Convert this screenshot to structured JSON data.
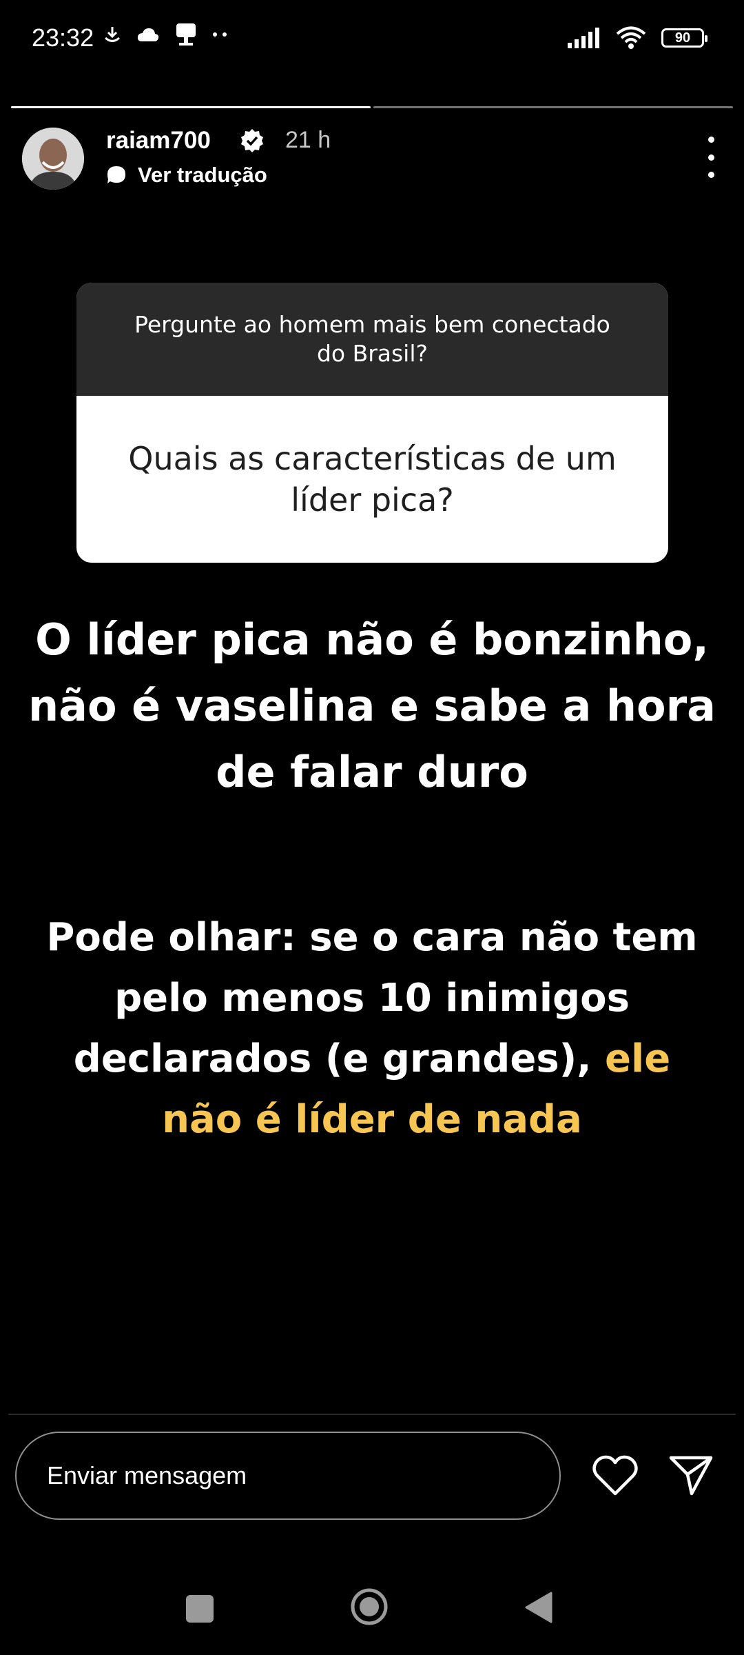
{
  "status_bar": {
    "time": "23:32",
    "battery": "90",
    "left_icons": [
      "download-icon",
      "cloud-icon",
      "mailbox-icon",
      "dots-icon"
    ],
    "right_icons": [
      "signal-icon",
      "wifi-icon",
      "battery-icon"
    ]
  },
  "story": {
    "segments_total": 2,
    "segments_done": 1,
    "username": "raiam700",
    "verified": true,
    "time_ago": "21 h",
    "translate_label": "Ver tradução"
  },
  "question_box": {
    "prompt": "Pergunte ao homem mais bem conectado do Brasil?",
    "question": "Quais as características de um líder pica?"
  },
  "answer": {
    "paragraph1": "O líder pica não é bonzinho, não é vaselina e sabe a hora de falar duro",
    "paragraph2_plain": "Pode olhar: se o cara não tem pelo menos 10 inimigos declarados (e grandes), ",
    "paragraph2_highlight": "ele não é líder de nada",
    "highlight_color": "#f7c552"
  },
  "reply_bar": {
    "placeholder": "Enviar mensagem",
    "like_icon": "heart-icon",
    "send_icon": "send-icon"
  },
  "nav_bar": {
    "buttons": [
      "recents-button",
      "home-button",
      "back-button"
    ]
  }
}
